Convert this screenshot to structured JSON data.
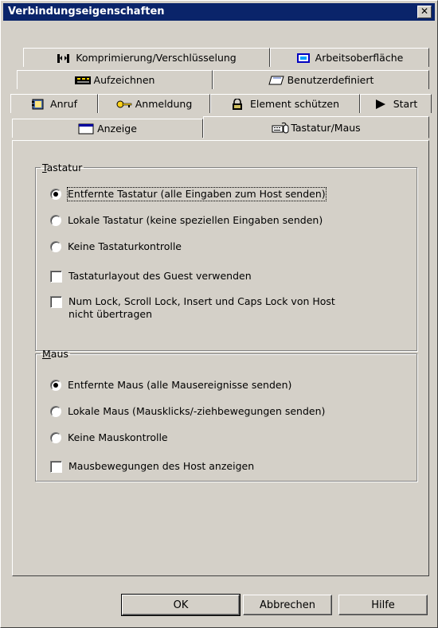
{
  "window": {
    "title": "Verbindungseigenschaften",
    "close_label": "✕"
  },
  "tabs": {
    "row1": [
      {
        "label": "Komprimierung/Verschlüsselung",
        "icon": "compression-icon"
      },
      {
        "label": "Arbeitsoberfläche",
        "icon": "desktop-icon"
      }
    ],
    "row2": [
      {
        "label": "Aufzeichnen",
        "icon": "record-icon"
      },
      {
        "label": "Benutzerdefiniert",
        "icon": "custom-icon"
      }
    ],
    "row3": [
      {
        "label": "Anruf",
        "icon": "phonebook-icon"
      },
      {
        "label": "Anmeldung",
        "icon": "key-icon"
      },
      {
        "label": "Element schützen",
        "icon": "lock-icon"
      },
      {
        "label": "Start",
        "icon": "play-icon"
      }
    ],
    "row4": [
      {
        "label": "Anzeige",
        "icon": "display-icon"
      },
      {
        "label": "Tastatur/Maus",
        "icon": "keyboard-mouse-icon",
        "active": true
      }
    ]
  },
  "keyboard": {
    "legend_accel": "T",
    "legend_rest": "astatur",
    "options": [
      {
        "label": "Entfernte Tastatur (alle Eingaben zum Host senden)",
        "checked": true
      },
      {
        "label": "Lokale Tastatur (keine speziellen Eingaben senden)",
        "checked": false
      },
      {
        "label": "Keine Tastaturkontrolle",
        "checked": false
      }
    ],
    "check1": "Tastaturlayout des Guest verwenden",
    "check2_line1": "Num Lock, Scroll Lock, Insert und Caps Lock von Host",
    "check2_line2": "nicht übertragen"
  },
  "mouse": {
    "legend_accel": "M",
    "legend_rest": "aus",
    "options": [
      {
        "label": "Entfernte Maus (alle Mausereignisse senden)",
        "checked": true
      },
      {
        "label": "Lokale Maus (Mausklicks/-ziehbewegungen senden)",
        "checked": false
      },
      {
        "label": "Keine Mauskontrolle",
        "checked": false
      }
    ],
    "check1": "Mausbewegungen des Host anzeigen"
  },
  "buttons": {
    "ok": "OK",
    "cancel": "Abbrechen",
    "help": "Hilfe"
  }
}
